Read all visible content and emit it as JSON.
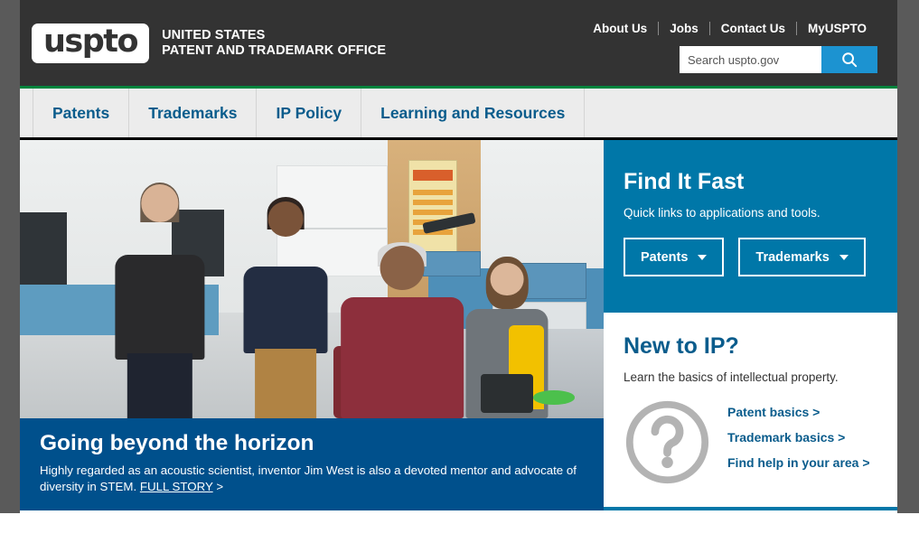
{
  "colors": {
    "header_bg": "#333333",
    "green_rule": "#00843d",
    "nav_bg": "#ececec",
    "nav_link": "#0a5c8c",
    "teal_panel": "#0077a8",
    "dark_blue_caption": "#00508c",
    "search_button": "#1c93d1",
    "gutter_gray": "#5a5a5a"
  },
  "header": {
    "logo_mark": "uspto",
    "logo_line1": "UNITED STATES",
    "logo_line2": "PATENT AND TRADEMARK OFFICE",
    "utility_links": [
      {
        "label": "About Us"
      },
      {
        "label": "Jobs"
      },
      {
        "label": "Contact Us"
      },
      {
        "label": "MyUSPTO"
      }
    ],
    "search": {
      "placeholder": "Search uspto.gov",
      "value": "",
      "button_icon": "search-icon"
    }
  },
  "main_nav": {
    "items": [
      {
        "label": "Patents"
      },
      {
        "label": "Trademarks"
      },
      {
        "label": "IP Policy"
      },
      {
        "label": "Learning and Resources"
      }
    ]
  },
  "hero": {
    "image_alt": "Researchers working together at a laboratory bench",
    "title": "Going beyond the horizon",
    "description_before_link": "Highly regarded as an acoustic scientist, inventor Jim West is also a devoted mentor and advocate of diversity in STEM. ",
    "link_label": "FULL STORY",
    "link_suffix": " >"
  },
  "find_it_fast": {
    "title": "Find It Fast",
    "subtitle": "Quick links to applications and tools.",
    "buttons": [
      {
        "label": "Patents",
        "icon": "chevron-down-icon"
      },
      {
        "label": "Trademarks",
        "icon": "chevron-down-icon"
      }
    ]
  },
  "new_to_ip": {
    "title": "New to IP?",
    "subtitle": "Learn the basics of intellectual property.",
    "icon": "question-mark-circle-icon",
    "links": [
      {
        "label": "Patent basics >"
      },
      {
        "label": "Trademark basics >"
      },
      {
        "label": "Find help in your area >"
      }
    ]
  }
}
